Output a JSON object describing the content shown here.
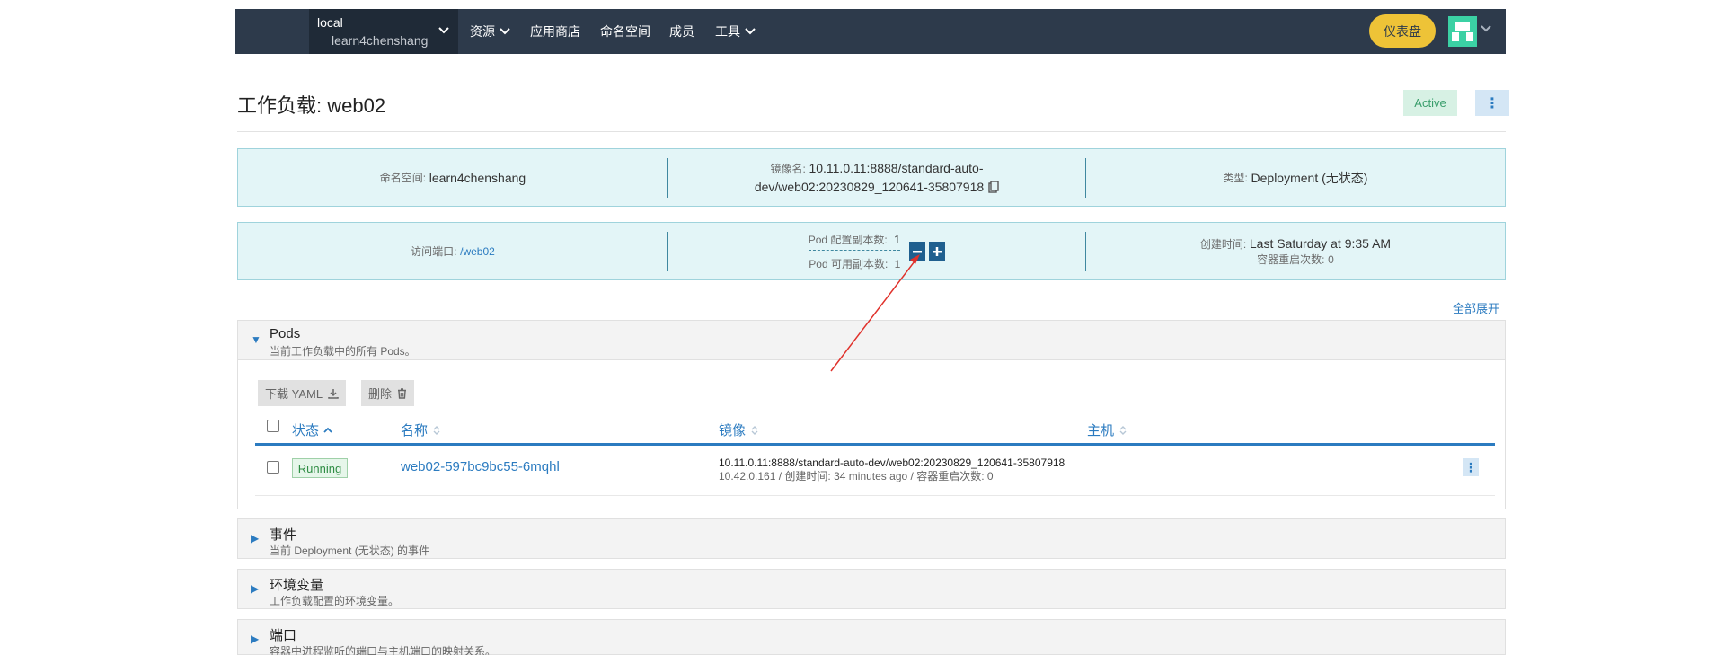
{
  "header": {
    "cluster_name": "local",
    "project_name": "learn4chenshang",
    "nav": [
      {
        "label": "资源",
        "dropdown": true
      },
      {
        "label": "应用商店",
        "dropdown": false
      },
      {
        "label": "命名空间",
        "dropdown": false
      },
      {
        "label": "成员",
        "dropdown": false
      },
      {
        "label": "工具",
        "dropdown": true
      }
    ],
    "dashboard_label": "仪表盘",
    "avatar_icon": "user-avatar-icon"
  },
  "page": {
    "title": "工作负载: web02",
    "state": "Active",
    "expand_all": "全部展开"
  },
  "info1": {
    "namespace_label": "命名空间:",
    "namespace_value": "learn4chenshang",
    "image_label": "镜像名:",
    "image_value_1": "10.11.0.11:8888/standard-auto-",
    "image_value_2": "dev/web02:20230829_120641-35807918",
    "type_label": "类型:",
    "type_value": "Deployment (无状态)"
  },
  "info2": {
    "endpoint_label": "访问端口:",
    "endpoint_value": "/web02",
    "scale_label": "Pod 配置副本数:",
    "scale_value": "1",
    "available_label": "Pod 可用副本数:",
    "available_value": "1",
    "created_label": "创建时间:",
    "created_value": "Last Saturday at 9:35 AM",
    "restarts_label": "容器重启次数:",
    "restarts_value": "0"
  },
  "pods_section": {
    "title": "Pods",
    "desc": "当前工作负载中的所有 Pods。",
    "download_yaml": "下载 YAML",
    "delete": "删除",
    "columns": {
      "state": "状态",
      "name": "名称",
      "image": "镜像",
      "host": "主机"
    },
    "rows": [
      {
        "state": "Running",
        "name": "web02-597bc9bc55-6mqhl",
        "image": "10.11.0.11:8888/standard-auto-dev/web02:20230829_120641-35807918",
        "ip": "10.42.0.161",
        "created_label": "创建时间:",
        "created": "34 minutes ago",
        "restarts_label": "容器重启次数:",
        "restarts": "0"
      }
    ]
  },
  "sections": [
    {
      "title": "事件",
      "desc": "当前 Deployment (无状态) 的事件"
    },
    {
      "title": "环境变量",
      "desc": "工作负载配置的环境变量。"
    },
    {
      "title": "端口",
      "desc": "容器中进程监听的端口与主机端口的映射关系。"
    }
  ],
  "colors": {
    "topbar": "#2d3a4b",
    "accent": "#2b7bc0",
    "dashboard_button": "#eec337",
    "info_bg": "#e3f5f7",
    "active_badge_bg": "#d7f1e4",
    "annotation_arrow": "#e0312b"
  }
}
